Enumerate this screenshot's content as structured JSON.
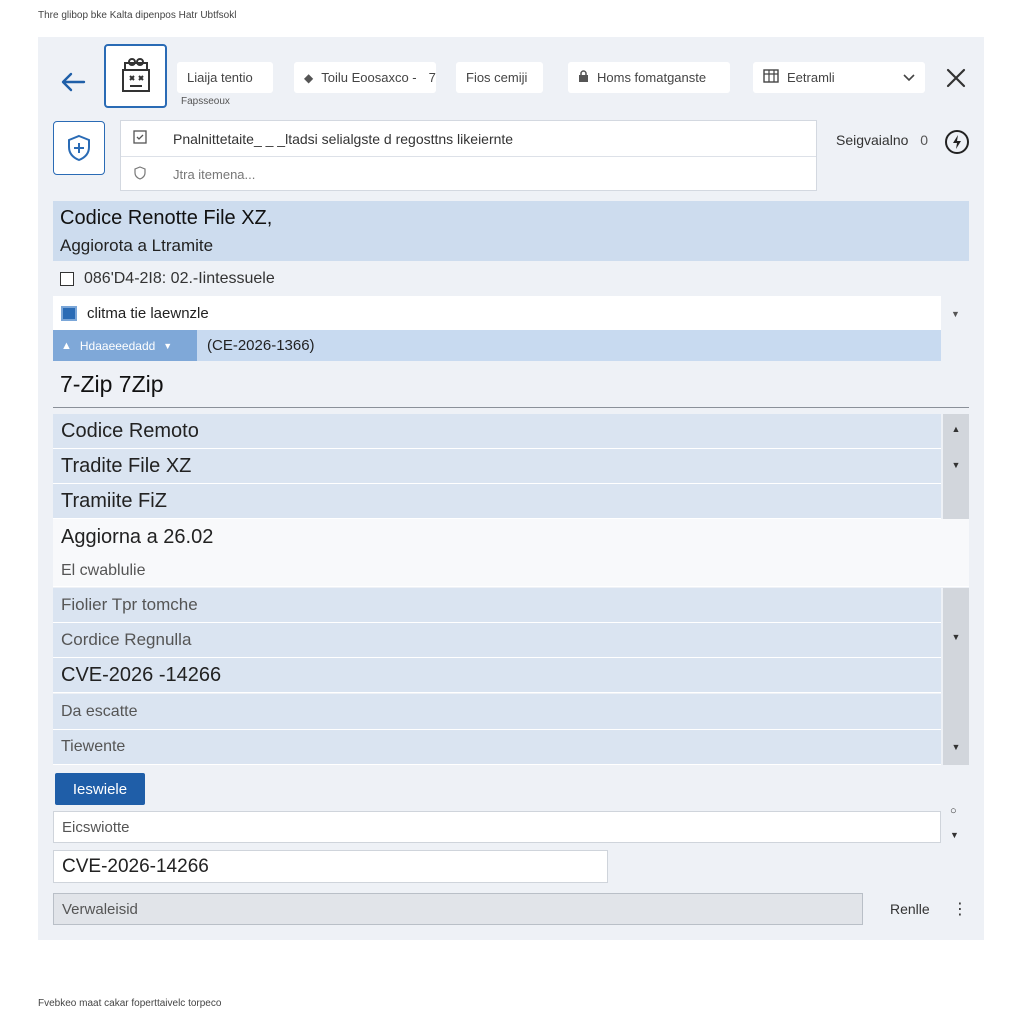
{
  "captions": {
    "top": "Thre glibop bke Kalta dipenpos Hatr Ubtfsokl",
    "bottom": "Fvebkeo maat cakar foperttaivelc torpeco"
  },
  "toolbar": {
    "chip1": "Liaija tentio",
    "chip1_sub": "Fapsseoux",
    "chip2": "Toilu Eoosaxco -",
    "chip2_glyph": "7",
    "chip3": "Fios cemiji",
    "chip4": "Homs fomatganste",
    "chip5": "Eetramli"
  },
  "search": {
    "row1": "Pnalnittetaite_ _ _ltadsi selialgste d regosttns likeiernte",
    "row2": "Jtra itemena...",
    "side_label": "Seigvaialno",
    "side_glyph": "0"
  },
  "header": {
    "title": "Codice Renotte File XZ,",
    "subtitle": "Aggiorota a Ltramite",
    "date_line": "086'D4-2I8: 02.-Iintessuele",
    "select_value": "clitma tie laewnzle",
    "dropdown_label": "Hdaaeeedadd",
    "dropdown_value": "(CE-2026-1366)"
  },
  "app_name": "7-Zip 7Zip",
  "list": {
    "items": [
      "Codice Remoto",
      "Tradite File XZ",
      "Tramiite FiZ",
      "Aggiorna a  26.02",
      "El cwablulie",
      "Fiolier Tpr tomche",
      "Cordice Regnulla",
      "CVE-2026 -14266",
      "Da escatte",
      "Tiewente"
    ]
  },
  "actions": {
    "primary": "Ieswiele",
    "field1": "Eicswiotte",
    "field2": "CVE-2026-14266",
    "footer_button": "Verwaleisid",
    "footer_right": "Renlle"
  },
  "colors": {
    "accent": "#1f5ea8",
    "header_bg": "#cddcee",
    "row_bg": "#dae4f1"
  }
}
